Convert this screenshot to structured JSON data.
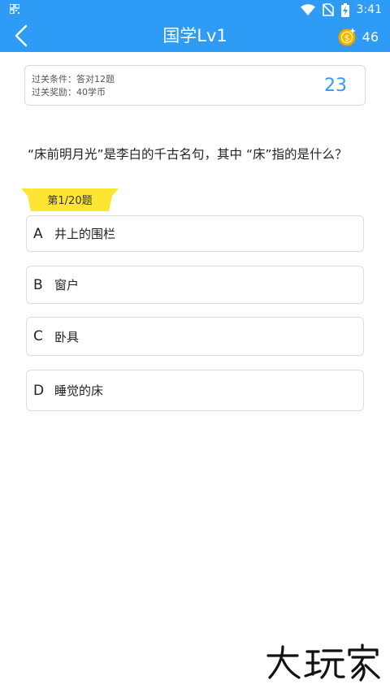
{
  "status_bar": {
    "time": "3:41",
    "icons": [
      "qr-icon",
      "wifi-icon",
      "no-sim-icon",
      "battery-charging-icon"
    ]
  },
  "app_bar": {
    "title": "国学Lv1",
    "coins": "46",
    "back_icon": "chevron-left-icon",
    "coin_icon": "coin-icon"
  },
  "conditions": {
    "pass_condition": "过关条件：答对12题",
    "pass_reward": "过关奖励：40学币",
    "timer": "23"
  },
  "question": {
    "text": "“床前明月光”是李白的千古名句，其中 “床”指的是什么？",
    "progress_label": "第1/20题"
  },
  "options": [
    {
      "letter": "A",
      "text": "井上的围栏"
    },
    {
      "letter": "B",
      "text": "窗户"
    },
    {
      "letter": "C",
      "text": "卧具"
    },
    {
      "letter": "D",
      "text": "睡觉的床"
    }
  ],
  "watermark": "大玩家",
  "colors": {
    "primary": "#2e9cf6",
    "ribbon": "#ffe533",
    "coin": "#f5b800"
  }
}
